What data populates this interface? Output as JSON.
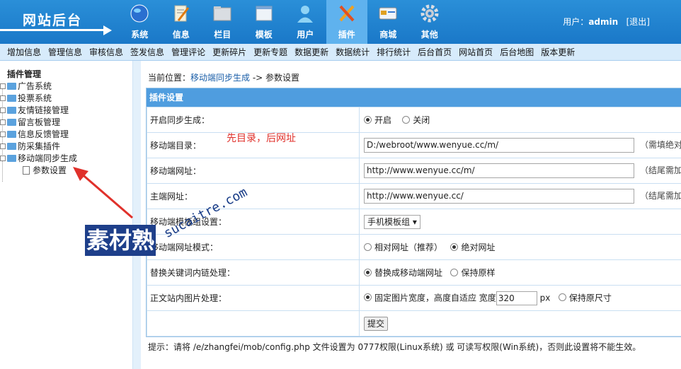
{
  "header": {
    "logo_title": "网站后台",
    "user_label": "用户：",
    "user_name": "admin",
    "logout": "[退出]",
    "nav": [
      {
        "label": "系统",
        "icon": "globe-icon"
      },
      {
        "label": "信息",
        "icon": "edit-icon"
      },
      {
        "label": "栏目",
        "icon": "folder-icon"
      },
      {
        "label": "模板",
        "icon": "window-icon"
      },
      {
        "label": "用户",
        "icon": "user-icon"
      },
      {
        "label": "插件",
        "icon": "tools-icon",
        "active": true
      },
      {
        "label": "商城",
        "icon": "card-icon"
      },
      {
        "label": "其他",
        "icon": "gear-icon"
      }
    ]
  },
  "subnav": [
    "增加信息",
    "管理信息",
    "审核信息",
    "签发信息",
    "管理评论",
    "更新碎片",
    "更新专题",
    "数据更新",
    "数据统计",
    "排行统计",
    "后台首页",
    "网站首页",
    "后台地图",
    "版本更新"
  ],
  "sidebar": {
    "root": "插件管理",
    "items": [
      "广告系统",
      "投票系统",
      "友情链接管理",
      "留言板管理",
      "信息反馈管理",
      "防采集插件",
      "移动端同步生成"
    ],
    "leaf": "参数设置"
  },
  "main": {
    "crumb_prefix": "当前位置：",
    "crumb_link": "移动端同步生成",
    "crumb_suffix": " -> 参数设置",
    "panel_title": "插件设置",
    "rows": {
      "sync_label": "开启同步生成：",
      "sync_on": "开启",
      "sync_off": "关闭",
      "dir_label": "移动端目录：",
      "dir_value": "D:/webroot/www.wenyue.cc/m/",
      "dir_hint": "（需填绝对",
      "mobile_url_label": "移动端网址：",
      "mobile_url_value": "http://www.wenyue.cc/m/",
      "mobile_url_hint": "（结尾需加",
      "main_url_label": "主端网址：",
      "main_url_value": "http://www.wenyue.cc/",
      "main_url_hint": "（结尾需加",
      "tpl_label": "移动端模板组设置：",
      "tpl_value": "手机模板组",
      "mode_label": "移动端网址模式：",
      "mode_rel": "相对网址（推荐）",
      "mode_abs": "绝对网址",
      "kw_label": "替换关键词内链处理：",
      "kw_replace": "替换成移动端网址",
      "kw_keep": "保持原样",
      "img_label": "正文站内图片处理：",
      "img_fixed": "固定图片宽度，高度自适应 宽度",
      "img_width": "320",
      "img_unit": "px",
      "img_keep": "保持原尺寸",
      "submit": "提交"
    },
    "note": "提示：请将 /e/zhangfei/mob/config.php 文件设置为 0777权限(Linux系统) 或 可读写权限(Win系统)，否则此设置将不能生效。"
  },
  "annotation": "先目录，后网址",
  "watermark": {
    "text1": "素材熟",
    "text2": "sucaitre.com"
  }
}
